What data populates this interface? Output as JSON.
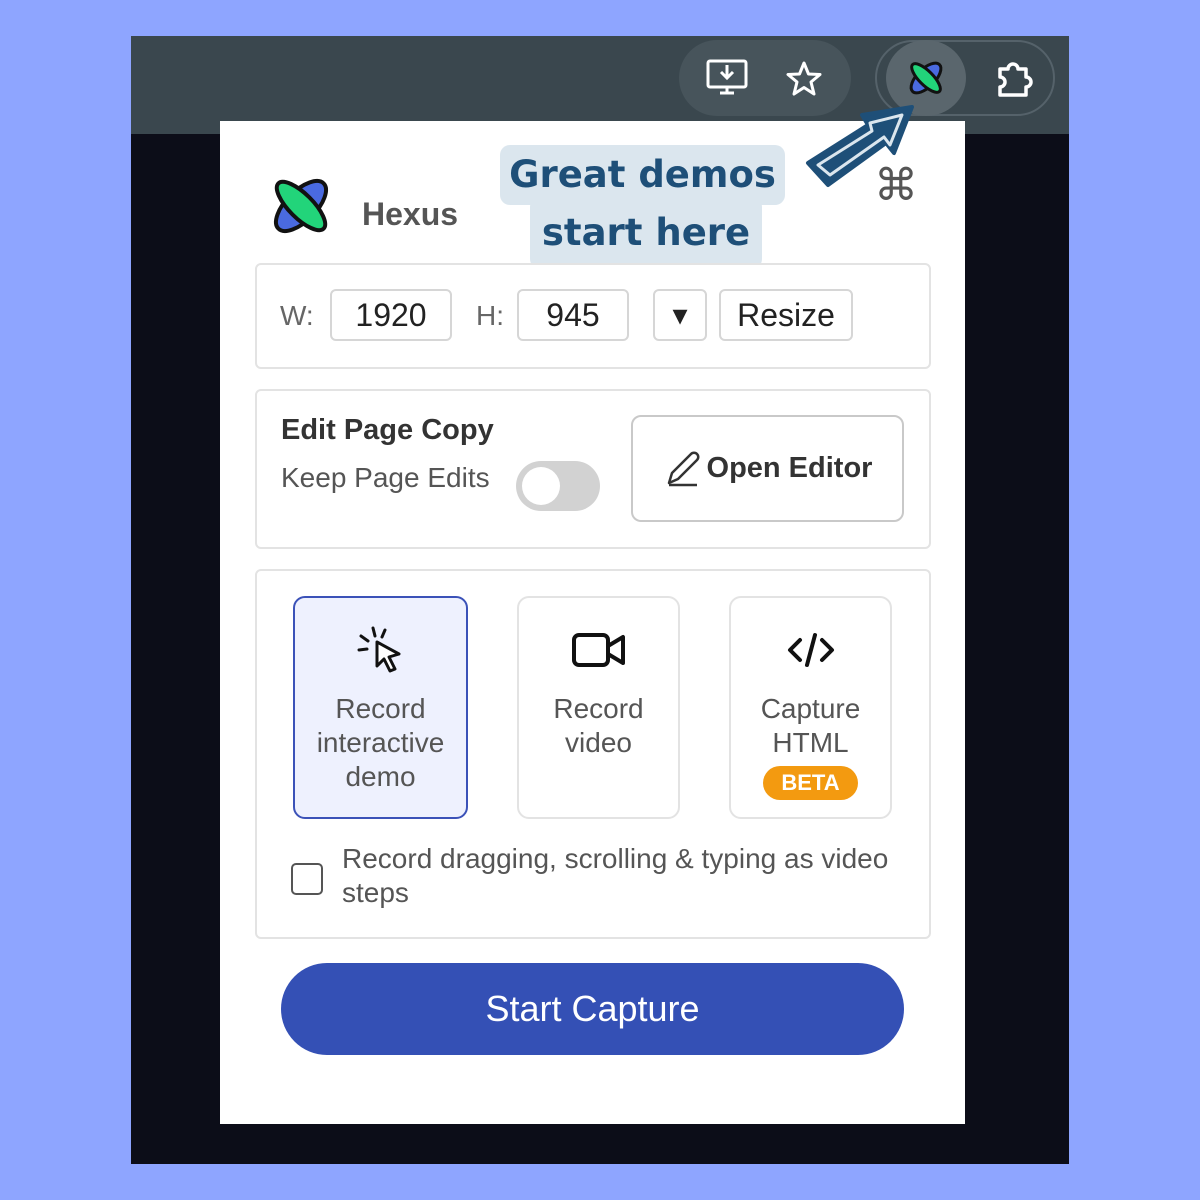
{
  "brand": {
    "name": "Hexus"
  },
  "callout": {
    "line1": "Great demos",
    "line2": "start here"
  },
  "shortcut_symbol": "⌘",
  "browser_toolbar": {
    "icons": [
      "install-app-icon",
      "bookmark-star-icon",
      "hexus-extension-icon",
      "extensions-puzzle-icon"
    ]
  },
  "resize": {
    "width_label": "W:",
    "width_value": "1920",
    "height_label": "H:",
    "height_value": "945",
    "dropdown_symbol": "▾",
    "resize_label": "Resize"
  },
  "edit_copy": {
    "title": "Edit Page Copy",
    "keep_edits_label": "Keep Page Edits",
    "keep_edits_on": false,
    "open_editor_label": "Open Editor"
  },
  "capture_options": [
    {
      "label": "Record\ninteractive\ndemo",
      "icon": "cursor-click-icon",
      "selected": true
    },
    {
      "label": "Record\nvideo",
      "icon": "video-camera-icon",
      "selected": false
    },
    {
      "label": "Capture\nHTML",
      "icon": "code-icon",
      "selected": false,
      "badge": "BETA"
    }
  ],
  "record_drag_checkbox": {
    "label": "Record dragging, scrolling & typing as video steps",
    "checked": false
  },
  "start_button": {
    "label": "Start Capture"
  },
  "colors": {
    "accent": "#3450b5",
    "beta_badge": "#f39a10",
    "brand_green": "#22d47a",
    "brand_blue": "#4a6ae0",
    "callout_text": "#1e4f78"
  }
}
